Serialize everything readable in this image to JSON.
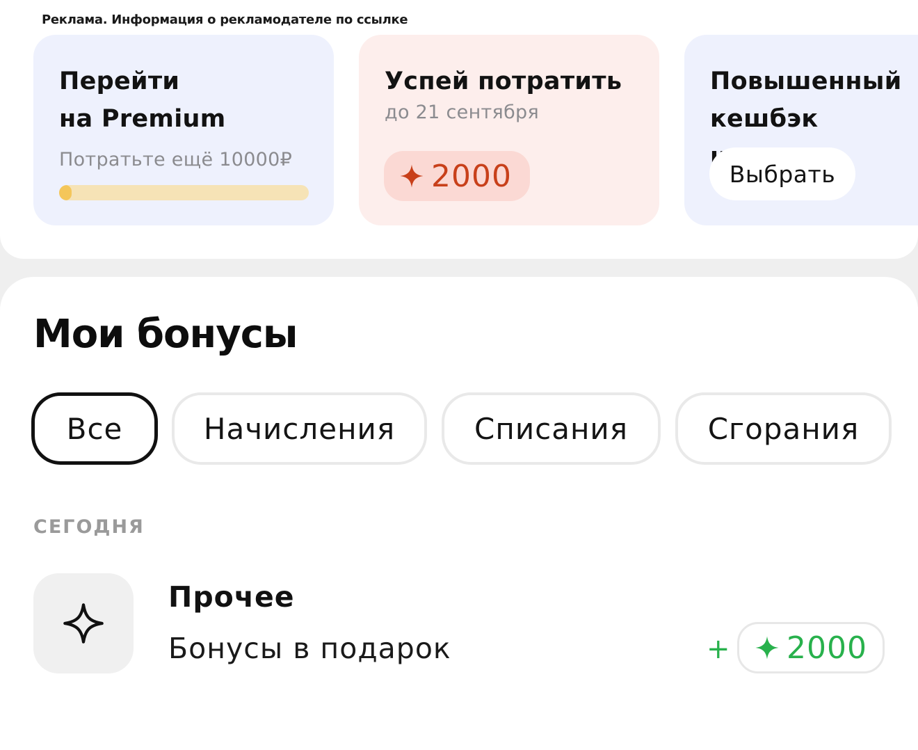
{
  "ad": {
    "label": "Реклама. Информация о рекламодателе по ссылке"
  },
  "promos": [
    {
      "title": "Перейти\nна Premium",
      "subtitle": "Потратьте ещё 10000₽",
      "progress_fraction": 0.04,
      "progress_track_color": "#f6e3b6",
      "progress_fill_color": "#f4c65a"
    },
    {
      "title": "Успей потратить",
      "subtitle": "до 21 сентября",
      "bonus_amount": "2000",
      "bonus_icon": "sparkle-icon",
      "accent_color": "#c8401a"
    },
    {
      "title": "Повышенный кешбэк\nна месяц",
      "button_label": "Выбрать"
    }
  ],
  "bonuses": {
    "title": "Мои бонусы",
    "filters": [
      {
        "label": "Все",
        "active": true
      },
      {
        "label": "Начисления",
        "active": false
      },
      {
        "label": "Списания",
        "active": false
      },
      {
        "label": "Сгорания",
        "active": false
      }
    ],
    "groups": [
      {
        "date_label": "СЕГОДНЯ",
        "transactions": [
          {
            "icon": "sparkle-outline-icon",
            "title": "Прочее",
            "subtitle": "Бонусы в подарок",
            "sign": "+",
            "amount": "2000",
            "amount_color": "#28b14c"
          }
        ]
      }
    ]
  }
}
